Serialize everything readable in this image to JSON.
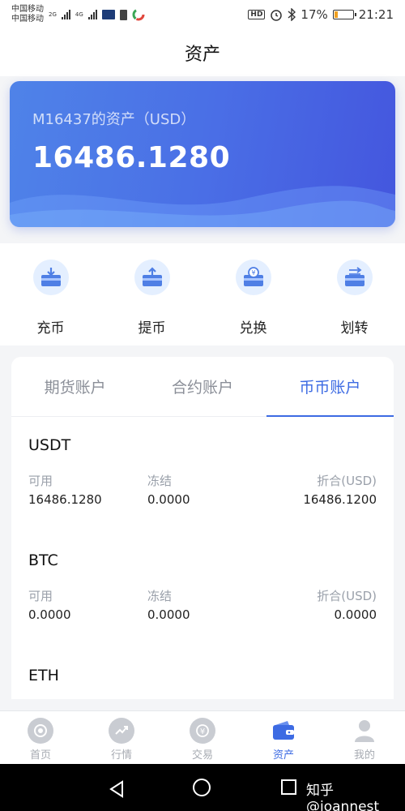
{
  "status_bar": {
    "carrier_1": "中国移动",
    "carrier_2": "中国移动",
    "net_1": "2G",
    "net_2": "4G",
    "hd": "HD",
    "battery_text": "17%",
    "battery_level": 0.17,
    "time": "21:21"
  },
  "header": {
    "title": "资产"
  },
  "asset_card": {
    "title": "M16437的资产（USD）",
    "total": "16486.1280"
  },
  "actions": [
    {
      "label": "充币",
      "icon": "deposit-icon"
    },
    {
      "label": "提币",
      "icon": "withdraw-icon"
    },
    {
      "label": "兑换",
      "icon": "exchange-icon"
    },
    {
      "label": "划转",
      "icon": "transfer-icon"
    }
  ],
  "tabs": [
    {
      "label": "期货账户",
      "active": false
    },
    {
      "label": "合约账户",
      "active": false
    },
    {
      "label": "币币账户",
      "active": true
    }
  ],
  "columns": {
    "available": "可用",
    "frozen": "冻结",
    "converted": "折合(USD)"
  },
  "coins": [
    {
      "name": "USDT",
      "available": "16486.1280",
      "frozen": "0.0000",
      "converted": "16486.1200"
    },
    {
      "name": "BTC",
      "available": "0.0000",
      "frozen": "0.0000",
      "converted": "0.0000"
    },
    {
      "name": "ETH"
    }
  ],
  "bottom_nav": [
    {
      "label": "首页",
      "icon": "home-icon",
      "active": false
    },
    {
      "label": "行情",
      "icon": "market-icon",
      "active": false
    },
    {
      "label": "交易",
      "icon": "trade-icon",
      "active": false
    },
    {
      "label": "资产",
      "icon": "wallet-icon",
      "active": true
    },
    {
      "label": "我的",
      "icon": "profile-icon",
      "active": false
    }
  ],
  "watermark": "知乎 @joannest",
  "colors": {
    "primary": "#3d6be3",
    "card_start": "#4f83e8",
    "card_end": "#4456de"
  }
}
